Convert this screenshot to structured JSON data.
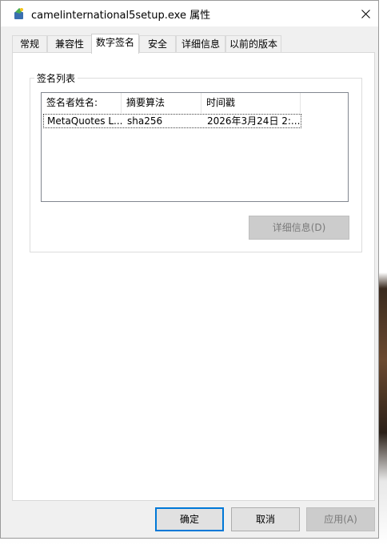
{
  "window": {
    "title": "camelinternational5setup.exe 属性",
    "close_glyph": "✕"
  },
  "tabs": [
    {
      "label": "常规"
    },
    {
      "label": "兼容性"
    },
    {
      "label": "数字签名",
      "active": true
    },
    {
      "label": "安全"
    },
    {
      "label": "详细信息"
    },
    {
      "label": "以前的版本"
    }
  ],
  "signature_list": {
    "group_label": "签名列表",
    "columns": [
      "签名者姓名:",
      "摘要算法",
      "时间戳"
    ],
    "rows": [
      [
        "MetaQuotes L...",
        "sha256",
        "2026年3月24日 2:..."
      ]
    ],
    "details_button": "详细信息(D)"
  },
  "footer": {
    "ok": "确定",
    "cancel": "取消",
    "apply": "应用(A)"
  },
  "colors": {
    "focus_border": "#0078d7",
    "disabled_bg": "#cccccc"
  }
}
